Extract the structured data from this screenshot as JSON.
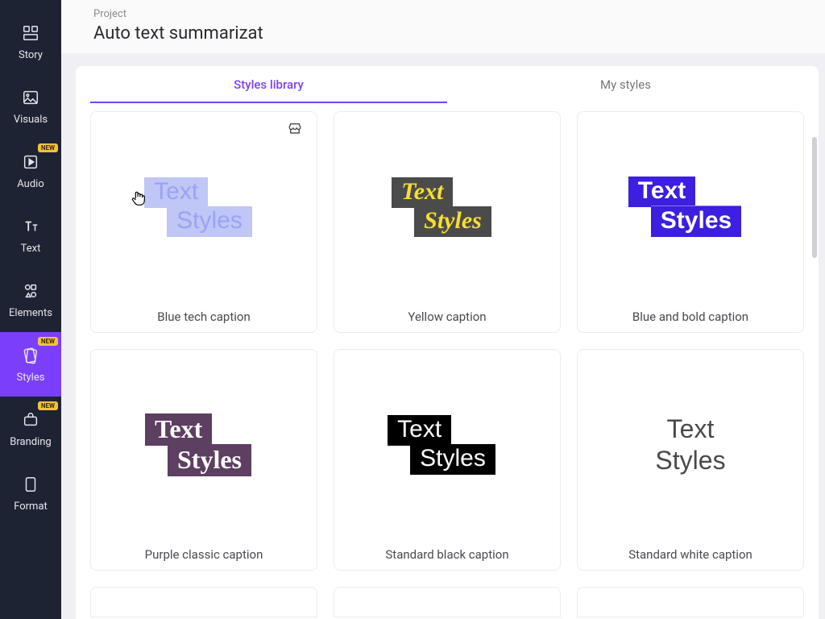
{
  "sidebar": {
    "items": [
      {
        "label": "Story",
        "icon": "story",
        "new": false,
        "active": false
      },
      {
        "label": "Visuals",
        "icon": "visuals",
        "new": false,
        "active": false
      },
      {
        "label": "Audio",
        "icon": "audio",
        "new": true,
        "active": false
      },
      {
        "label": "Text",
        "icon": "text",
        "new": false,
        "active": false
      },
      {
        "label": "Elements",
        "icon": "elements",
        "new": false,
        "active": false
      },
      {
        "label": "Styles",
        "icon": "styles",
        "new": true,
        "active": true
      },
      {
        "label": "Branding",
        "icon": "branding",
        "new": true,
        "active": false
      },
      {
        "label": "Format",
        "icon": "format",
        "new": false,
        "active": false
      }
    ],
    "new_badge": "NEW"
  },
  "header": {
    "project_label": "Project",
    "project_title": "Auto text summarizat"
  },
  "tabs": {
    "library": "Styles library",
    "my": "My styles",
    "active": "library"
  },
  "preview_text": {
    "line1": "Text",
    "line2": "Styles"
  },
  "cards": [
    {
      "label": "Blue tech caption"
    },
    {
      "label": "Yellow caption"
    },
    {
      "label": "Blue and bold caption"
    },
    {
      "label": "Purple classic caption"
    },
    {
      "label": "Standard black caption"
    },
    {
      "label": "Standard white caption"
    }
  ]
}
